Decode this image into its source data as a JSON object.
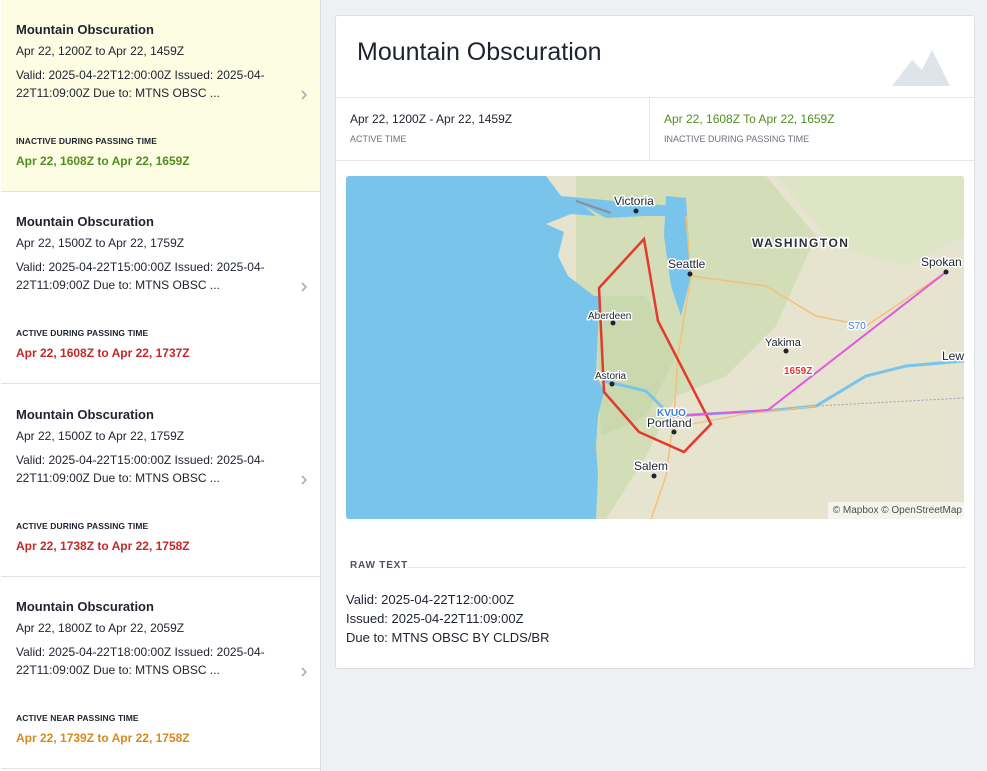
{
  "colors": {
    "inactive": "#4f8f1e",
    "active": "#c62828",
    "near": "#d9891b",
    "selected_bg": "#fdfde3",
    "route": "#e05ae0",
    "polygon": "#e23a2e",
    "water": "#79c4ea"
  },
  "advisories": [
    {
      "title": "Mountain Obscuration",
      "period": "Apr 22, 1200Z to Apr 22, 1459Z",
      "desc": "Valid: 2025-04-22T12:00:00Z Issued: 2025-04-22T11:09:00Z Due to: MTNS OBSC ...",
      "status_label": "INACTIVE DURING PASSING TIME",
      "status_range": "Apr 22, 1608Z to Apr 22, 1659Z",
      "status_color": "#4f8f1e",
      "selected": true
    },
    {
      "title": "Mountain Obscuration",
      "period": "Apr 22, 1500Z to Apr 22, 1759Z",
      "desc": "Valid: 2025-04-22T15:00:00Z Issued: 2025-04-22T11:09:00Z Due to: MTNS OBSC ...",
      "status_label": "ACTIVE DURING PASSING TIME",
      "status_range": "Apr 22, 1608Z to Apr 22, 1737Z",
      "status_color": "#c62828",
      "selected": false
    },
    {
      "title": "Mountain Obscuration",
      "period": "Apr 22, 1500Z to Apr 22, 1759Z",
      "desc": "Valid: 2025-04-22T15:00:00Z Issued: 2025-04-22T11:09:00Z Due to: MTNS OBSC ...",
      "status_label": "ACTIVE DURING PASSING TIME",
      "status_range": "Apr 22, 1738Z to Apr 22, 1758Z",
      "status_color": "#c62828",
      "selected": false
    },
    {
      "title": "Mountain Obscuration",
      "period": "Apr 22, 1800Z to Apr 22, 2059Z",
      "desc": "Valid: 2025-04-22T18:00:00Z Issued: 2025-04-22T11:09:00Z Due to: MTNS OBSC ...",
      "status_label": "ACTIVE NEAR PASSING TIME",
      "status_range": "Apr 22, 1739Z to Apr 22, 1758Z",
      "status_color": "#d9891b",
      "selected": false
    }
  ],
  "detail": {
    "title": "Mountain Obscuration",
    "active_time": "Apr 22, 1200Z - Apr 22, 1459Z",
    "active_time_label": "ACTIVE TIME",
    "inactive_time": "Apr 22, 1608Z To Apr 22, 1659Z",
    "inactive_time_label": "INACTIVE DURING PASSING TIME",
    "raw_text_label": "RAW TEXT",
    "raw_text_lines": [
      "Valid: 2025-04-22T12:00:00Z",
      "Issued: 2025-04-22T11:09:00Z",
      "Due to: MTNS OBSC BY CLDS/BR"
    ]
  },
  "map": {
    "labels": {
      "victoria": "Victoria",
      "washington": "WASHINGTON",
      "seattle": "Seattle",
      "spokane": "Spokan",
      "aberdeen": "Aberdeen",
      "s70": "S70",
      "yakima": "Yakima",
      "lewiston": "Lew",
      "astoria": "Astoria",
      "time_1659": "1659Z",
      "kvuo": "KVUO",
      "portland": "Portland",
      "salem": "Salem"
    },
    "attribution": "© Mapbox © OpenStreetMap"
  }
}
